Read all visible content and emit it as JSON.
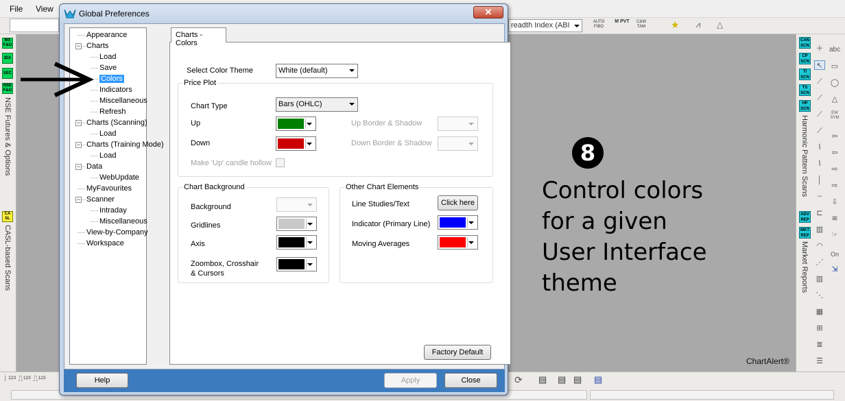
{
  "menu": {
    "file": "File",
    "view": "View"
  },
  "toolbar": {
    "index_combo": "readth Index (ABI",
    "autofibo": "AUTO FIBO",
    "mpvt": "M PVT",
    "cowtam": "C&W TAM",
    "tas": "TAS"
  },
  "left_strip": {
    "buttons": [
      "MX F&O",
      "IDX",
      "SEC",
      "NSE F&O"
    ],
    "vertical_label_1": "NSE Futures & Options",
    "casl_button": "CA SL",
    "vertical_label_2": "CASL-based Scans"
  },
  "right_strip": {
    "scan_buttons": [
      "CAN SCN",
      "CP SCN",
      "TI SCN",
      "TS SCN",
      "HP SCN"
    ],
    "vertical_label_1": "Harmonic Pattern Scans",
    "report_buttons": [
      "ADV REP",
      "MKT REP"
    ],
    "vertical_label_2": "Market Reports",
    "tool_labels": [
      "abc",
      "EW SYM",
      "On"
    ]
  },
  "dialog": {
    "title": "Global Preferences",
    "close_glyph": "✕",
    "tree": [
      {
        "label": "Appearance",
        "level": 1,
        "expander": false
      },
      {
        "label": "Charts",
        "level": 1,
        "expander": true
      },
      {
        "label": "Load",
        "level": 2
      },
      {
        "label": "Save",
        "level": 2
      },
      {
        "label": "Colors",
        "level": 2,
        "selected": true
      },
      {
        "label": "Indicators",
        "level": 2
      },
      {
        "label": "Miscellaneous",
        "level": 2
      },
      {
        "label": "Refresh",
        "level": 2
      },
      {
        "label": "Charts (Scanning)",
        "level": 1,
        "expander": true
      },
      {
        "label": "Load",
        "level": 2
      },
      {
        "label": "Charts (Training Mode)",
        "level": 1,
        "expander": true
      },
      {
        "label": "Load",
        "level": 2
      },
      {
        "label": "Data",
        "level": 1,
        "expander": true
      },
      {
        "label": "WebUpdate",
        "level": 2
      },
      {
        "label": "MyFavourites",
        "level": 1,
        "expander": false
      },
      {
        "label": "Scanner",
        "level": 1,
        "expander": true
      },
      {
        "label": "Intraday",
        "level": 2
      },
      {
        "label": "Miscellaneous",
        "level": 2
      },
      {
        "label": "View-by-Company",
        "level": 1,
        "expander": false
      },
      {
        "label": "Workspace",
        "level": 1,
        "expander": false
      }
    ],
    "tab_label": "Charts - Colors",
    "select_color_theme_label": "Select Color Theme",
    "color_theme_value": "White (default)",
    "price_plot": {
      "group_label": "Price Plot",
      "chart_type_label": "Chart Type",
      "chart_type_value": "Bars (OHLC)",
      "up_label": "Up",
      "up_color": "#008000",
      "down_label": "Down",
      "down_color": "#cc0000",
      "up_border_label": "Up Border & Shadow",
      "down_border_label": "Down Border & Shadow",
      "hollow_label": "Make 'Up' candle hollow"
    },
    "chart_background": {
      "group_label": "Chart Background",
      "background_label": "Background",
      "gridlines_label": "Gridlines",
      "gridlines_color": "#c8c8c8",
      "axis_label": "Axis",
      "axis_color": "#000000",
      "zoombox_label_line1": "Zoombox, Crosshair",
      "zoombox_label_line2": "& Cursors",
      "zoombox_color": "#000000"
    },
    "other_elements": {
      "group_label": "Other Chart Elements",
      "line_studies_label": "Line Studies/Text",
      "click_here": "Click here",
      "indicator_label": "Indicator (Primary Line)",
      "indicator_color": "#0000ff",
      "moving_averages_label": "Moving Averages",
      "moving_averages_color": "#ff0000"
    },
    "factory_default": "Factory Default",
    "help": "Help",
    "apply": "Apply",
    "close": "Close"
  },
  "annotation": {
    "step_number": "8",
    "lines": [
      "Control colors",
      "for a given",
      "User Interface",
      "theme"
    ],
    "arrow_glyph": "➔"
  },
  "watermark": "ChartAlert®"
}
